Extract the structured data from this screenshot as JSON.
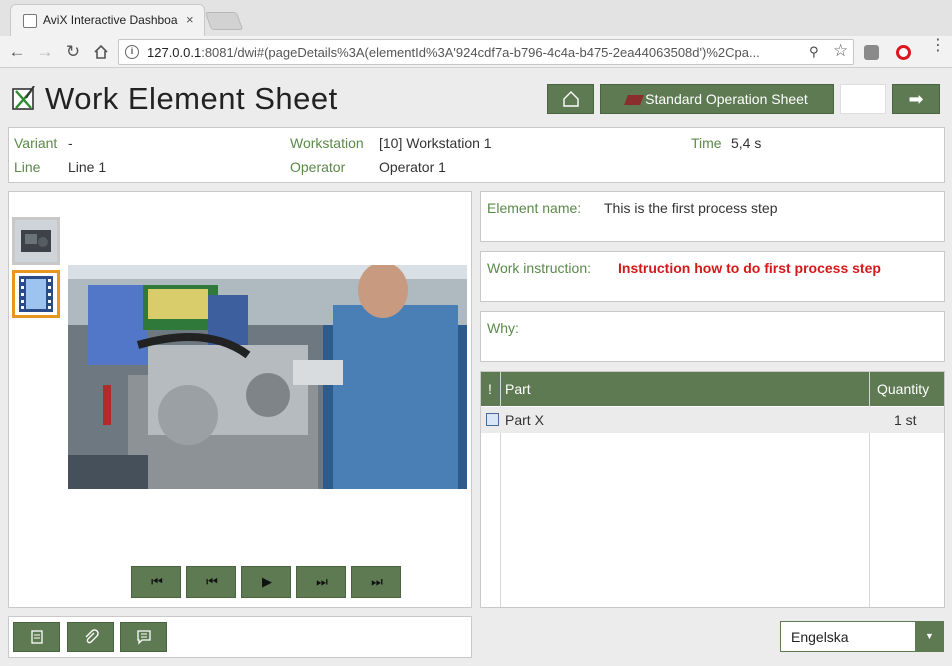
{
  "browser": {
    "tab_title": "AviX Interactive Dashboa",
    "tab_close": "×",
    "url_host": "127.0.0.1",
    "url_rest": ":8081/dwi#(pageDetails%3A(elementId%3A'924cdf7a-b796-4c4a-b475-2ea44063508d')%2Cpa..."
  },
  "header": {
    "title": "Work Element Sheet",
    "sos_label": "Standard Operation Sheet",
    "next_label": "➡"
  },
  "info": {
    "variant_label": "Variant",
    "variant_value": "-",
    "line_label": "Line",
    "line_value": "Line 1",
    "workstation_label": "Workstation",
    "workstation_value": "[10] Workstation 1",
    "operator_label": "Operator",
    "operator_value": "Operator 1",
    "time_label": "Time",
    "time_value": "5,4 s"
  },
  "element": {
    "name_label": "Element name:",
    "name_value": "This is the first process step",
    "instruction_label": "Work instruction:",
    "instruction_value": "Instruction how to do first process step",
    "why_label": "Why:"
  },
  "parts": {
    "col_flag": "!",
    "col_part": "Part",
    "col_quantity": "Quantity",
    "rows": [
      {
        "part": "Part X",
        "quantity": "1 st"
      }
    ]
  },
  "player": {
    "first": "⏮",
    "prev": "⏮",
    "play": "▶",
    "next": "⏭",
    "last": "⏭"
  },
  "language": {
    "selected": "Engelska",
    "arrow": "▼"
  },
  "colors": {
    "accent_green": "#5d7a52",
    "label_green": "#5a8a48",
    "instruction_red": "#d41919",
    "selected_thumb": "#e8961e"
  }
}
